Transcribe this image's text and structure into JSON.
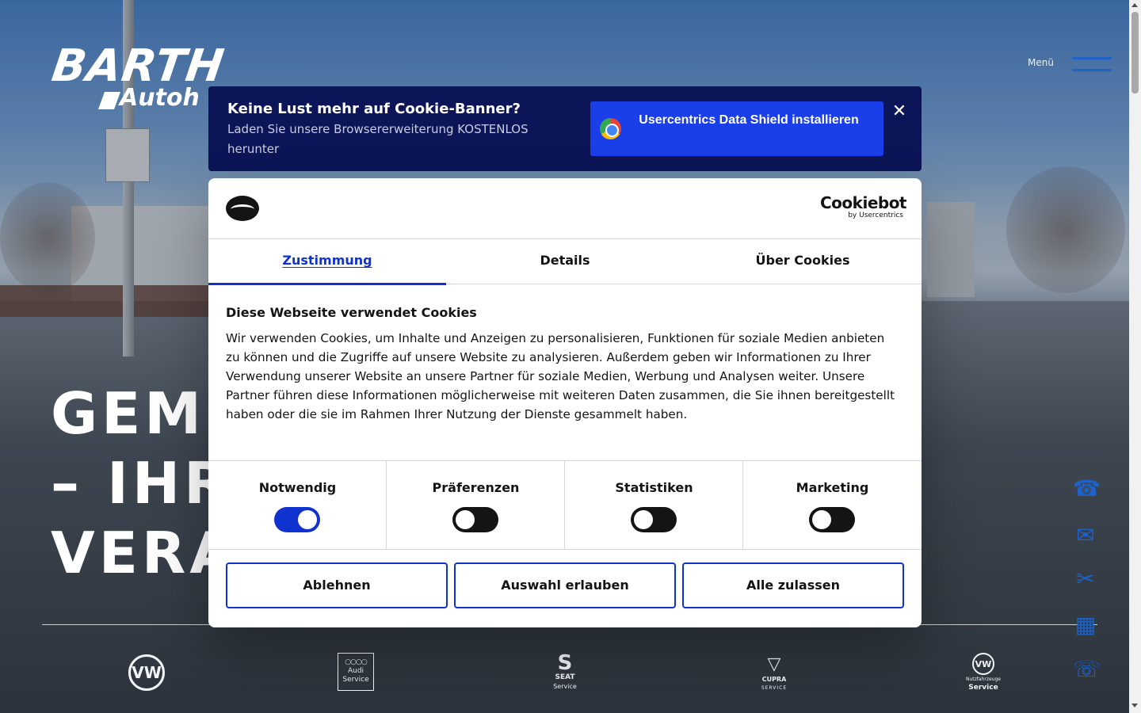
{
  "header": {
    "logo_main": "BARTH",
    "logo_sub": "Autoh",
    "menu_label": "Menü"
  },
  "hero": {
    "line1": "GEME",
    "line2": "– IHR",
    "line3": "VERA"
  },
  "brands": {
    "vw": "VW",
    "audi_rings": "○○○○",
    "audi_line1": "Audi",
    "audi_line2": "Service",
    "seat_mark": "S",
    "seat_line1": "SEAT",
    "seat_line2": "Service",
    "cupra_mark": "▽",
    "cupra_line": "CUPRA",
    "cupra_service": "SERVICE",
    "vwn_mark": "VW",
    "vwn_line1": "Nutzfahrzeuge",
    "vwn_line2": "Service"
  },
  "contact_rail": {
    "phone_icon": "☎",
    "mail_icon": "✉",
    "service_icon": "✂",
    "calendar_icon": "▦",
    "whatsapp_icon": "☏"
  },
  "usercentrics": {
    "title": "Keine Lust mehr auf Cookie-Banner?",
    "text": "Laden Sie unsere Browsererweiterung KOSTENLOS herunter",
    "button_label": "Usercentrics Data Shield installieren",
    "close_icon": "✕"
  },
  "cookiebot": {
    "brand_big": "Cookiebot",
    "brand_small": "by Usercentrics",
    "tabs": [
      {
        "label": "Zustimmung"
      },
      {
        "label": "Details"
      },
      {
        "label": "Über Cookies"
      }
    ],
    "heading": "Diese Webseite verwendet Cookies",
    "body": "Wir verwenden Cookies, um Inhalte und Anzeigen zu personalisieren, Funktionen für soziale Medien anbieten zu können und die Zugriffe auf unsere Website zu analysieren. Außerdem geben wir Informationen zu Ihrer Verwendung unserer Website an unsere Partner für soziale Medien, Werbung und Analysen weiter. Unsere Partner führen diese Informationen möglicherweise mit weiteren Daten zusammen, die Sie ihnen bereitgestellt haben oder die sie im Rahmen Ihrer Nutzung der Dienste gesammelt haben.",
    "categories": [
      {
        "label": "Notwendig",
        "enabled": true
      },
      {
        "label": "Präferenzen",
        "enabled": false
      },
      {
        "label": "Statistiken",
        "enabled": false
      },
      {
        "label": "Marketing",
        "enabled": false
      }
    ],
    "buttons": {
      "decline": "Ablehnen",
      "allow_selection": "Auswahl erlauben",
      "allow_all": "Alle zulassen"
    }
  },
  "colors": {
    "accent": "#1032cf",
    "banner_bg": "#0c1557",
    "banner_button": "#1a3ee8",
    "rail_icon": "#1e62c8"
  }
}
